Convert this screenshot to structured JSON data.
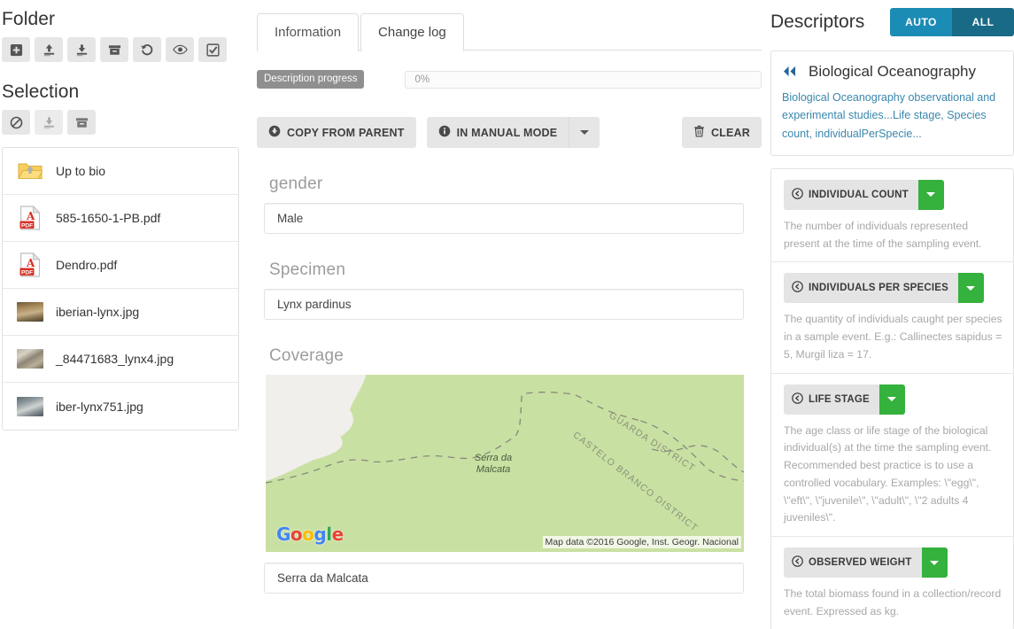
{
  "left": {
    "folder": {
      "title": "Folder",
      "actions": [
        {
          "name": "create-folder-button",
          "icon": "plus-square-icon",
          "state": "enabled"
        },
        {
          "name": "upload-button",
          "icon": "upload-icon",
          "state": "enabled"
        },
        {
          "name": "download-button",
          "icon": "download-icon",
          "state": "enabled"
        },
        {
          "name": "delete-button",
          "icon": "archive-box-icon",
          "state": "enabled"
        },
        {
          "name": "restore-button",
          "icon": "undo-icon",
          "state": "enabled"
        },
        {
          "name": "preview-button",
          "icon": "eye-icon",
          "state": "enabled"
        },
        {
          "name": "select-all-button",
          "icon": "check-square-icon",
          "state": "enabled"
        }
      ]
    },
    "selection": {
      "title": "Selection",
      "actions": [
        {
          "name": "deselect-button",
          "icon": "ban-icon",
          "state": "enabled"
        },
        {
          "name": "download-selection-button",
          "icon": "download-icon",
          "state": "disabled"
        },
        {
          "name": "delete-selection-button",
          "icon": "archive-box-icon",
          "state": "enabled"
        }
      ]
    },
    "files": [
      {
        "label": "Up to bio",
        "type": "folder-up"
      },
      {
        "label": "585-1650-1-PB.pdf",
        "type": "pdf"
      },
      {
        "label": "Dendro.pdf",
        "type": "pdf"
      },
      {
        "label": "iberian-lynx.jpg",
        "type": "image",
        "thumb": "t-lynx1"
      },
      {
        "label": "_84471683_lynx4.jpg",
        "type": "image",
        "thumb": "t-lynx2"
      },
      {
        "label": "iber-lynx751.jpg",
        "type": "image",
        "thumb": "t-lynx3"
      }
    ]
  },
  "center": {
    "tabs": [
      {
        "label": "Information",
        "active": true
      },
      {
        "label": "Change log",
        "active": false
      }
    ],
    "progress": {
      "label": "Description progress",
      "value_text": "0%",
      "percent": 0
    },
    "actions": {
      "copy_from_parent": "COPY FROM PARENT",
      "mode": "IN MANUAL MODE",
      "clear": "CLEAR"
    },
    "fields": [
      {
        "label": "gender",
        "value": "Male",
        "name": "gender-field"
      },
      {
        "label": "Specimen",
        "value": "Lynx pardinus",
        "name": "specimen-field"
      },
      {
        "label": "Coverage",
        "value": "Serra da Malcata",
        "name": "coverage-field"
      }
    ],
    "map": {
      "place_label": "Serra da\nMalcata",
      "place_label_line1": "Serra da",
      "place_label_line2": "Malcata",
      "district_1": "GUARDA DISTRICT",
      "district_2": "CASTELO BRANCO DISTRICT",
      "logo_letters": [
        "G",
        "o",
        "o",
        "g",
        "l",
        "e"
      ],
      "credit": "Map data ©2016 Google, Inst. Geogr. Nacional"
    }
  },
  "right": {
    "title": "Descriptors",
    "toggle": {
      "auto": "AUTO",
      "all": "ALL",
      "active": "AUTO"
    },
    "ontology_card": {
      "title": "Biological Oceanography",
      "description": "Biological Oceanography observational and experimental studies...Life stage, Species count, individualPerSpecie..."
    },
    "descriptors": [
      {
        "label": "INDIVIDUAL COUNT",
        "description": "The number of individuals represented present at the time of the sampling event."
      },
      {
        "label": "INDIVIDUALS PER SPECIES",
        "description": "The quantity of individuals caught per species in a sample event. E.g.: Callinectes sapidus = 5, Murgil liza = 17."
      },
      {
        "label": "LIFE STAGE",
        "description": "The age class or life stage of the biological individual(s) at the time the sampling event. Recommended best practice is to use a controlled vocabulary. Examples: \\\"egg\\\", \\\"eft\\\", \\\"juvenile\\\", \\\"adult\\\", \\\"2 adults 4 juveniles\\\"."
      },
      {
        "label": "OBSERVED WEIGHT",
        "description": "The total biomass found in a collection/record event. Expressed as kg."
      }
    ]
  },
  "colors": {
    "accent_blue": "#1b8cb5",
    "accent_blue_dark": "#196a87",
    "accent_green": "#35b13d",
    "link_blue": "#3a87ad",
    "muted_gray": "#8f8f8f"
  }
}
